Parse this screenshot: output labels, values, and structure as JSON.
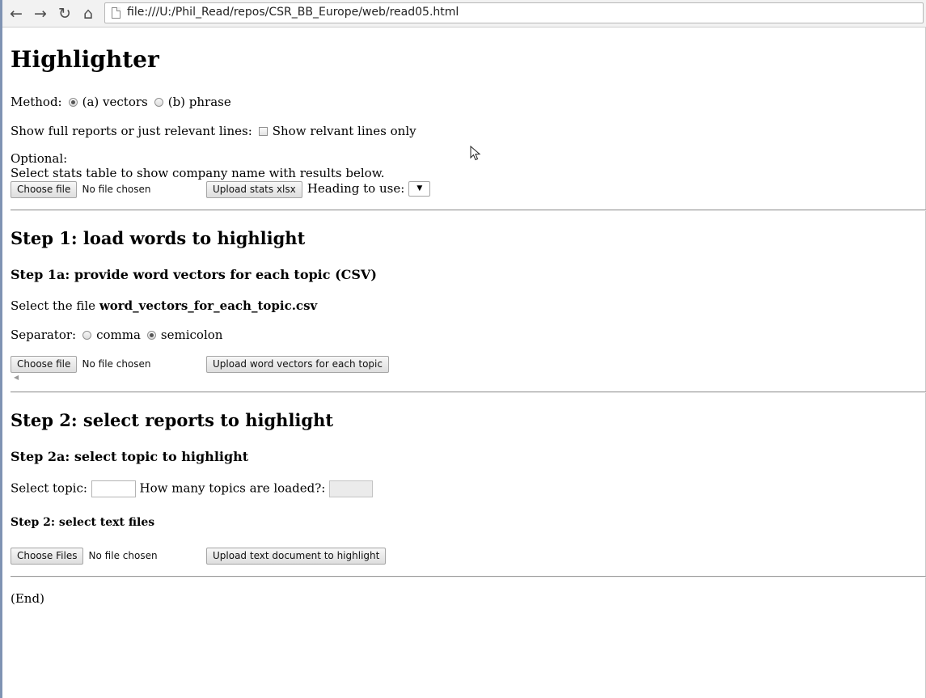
{
  "browser": {
    "url": "file:///U:/Phil_Read/repos/CSR_BB_Europe/web/read05.html"
  },
  "page": {
    "title": "Highlighter",
    "method": {
      "label": "Method:",
      "option_a": "(a) vectors",
      "option_b": "(b) phrase",
      "selected": "a"
    },
    "show_lines": {
      "label": "Show full reports or just relevant lines:",
      "checkbox_label": "Show relvant lines only"
    },
    "optional": {
      "label": "Optional:",
      "description": "Select stats table to show company name with results below.",
      "choose_button": "Choose file",
      "file_status": "No file chosen",
      "upload_button": "Upload stats xlsx",
      "heading_label": "Heading to use:"
    },
    "step1": {
      "heading": "Step 1: load words to highlight",
      "sub_heading": "Step 1a: provide word vectors for each topic (CSV)",
      "select_prefix": "Select the file ",
      "select_filename": "word_vectors_for_each_topic.csv",
      "separator_label": "Separator:",
      "separator_comma": "comma",
      "separator_semicolon": "semicolon",
      "separator_selected": "semicolon",
      "choose_button": "Choose file",
      "file_status": "No file chosen",
      "upload_button": "Upload word vectors for each topic"
    },
    "step2": {
      "heading": "Step 2: select reports to highlight",
      "sub_heading": "Step 2a: select topic to highlight",
      "select_topic_label": "Select topic:",
      "topics_loaded_label": "How many topics are loaded?:",
      "text_files_heading": "Step 2: select text files",
      "choose_button": "Choose Files",
      "file_status": "No file chosen",
      "upload_button": "Upload text document to highlight"
    },
    "end_text": "(End)"
  }
}
